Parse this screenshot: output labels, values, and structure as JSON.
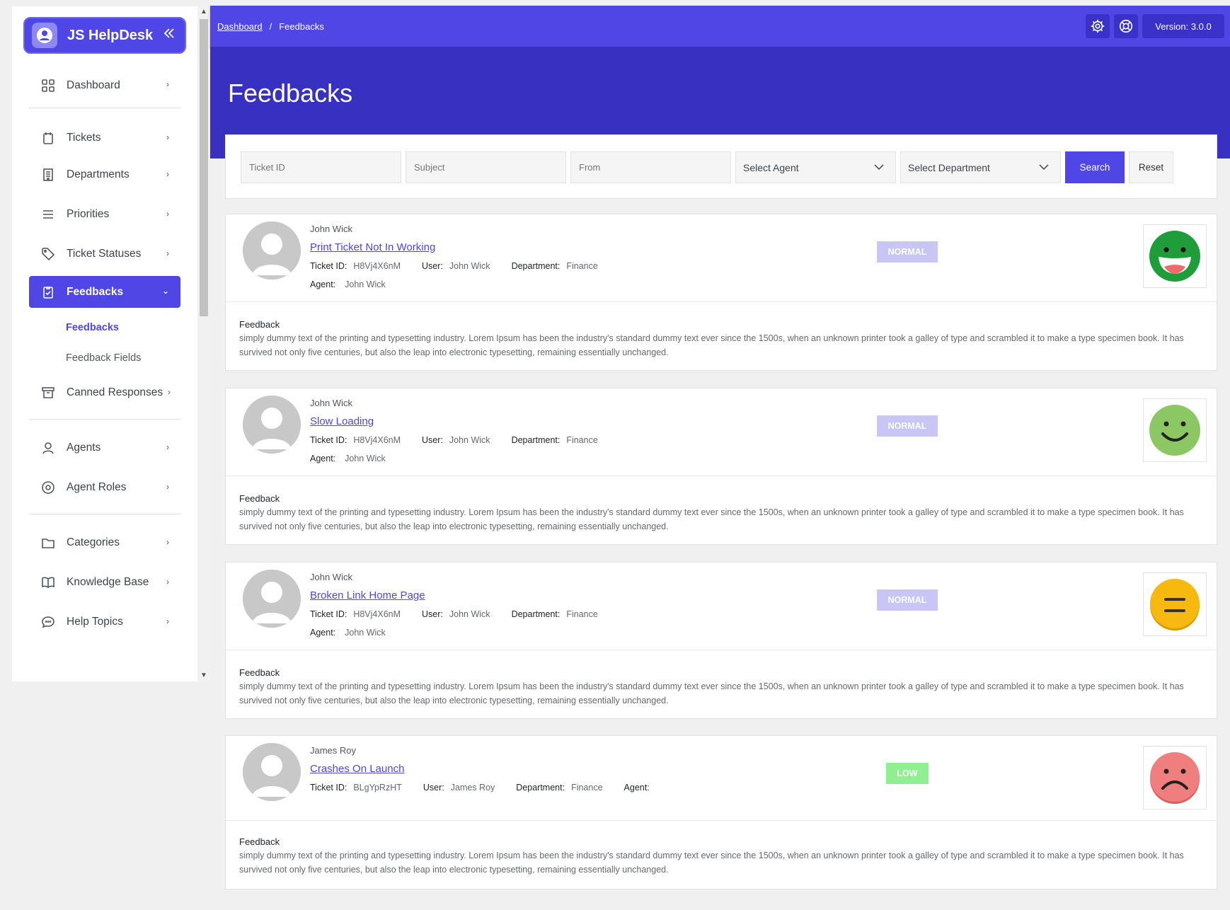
{
  "sidebar": {
    "brand": "JS HelpDesk",
    "items": [
      {
        "label": "Dashboard",
        "icon": "grid-icon"
      },
      {
        "label": "Tickets",
        "icon": "clipboard-icon"
      },
      {
        "label": "Departments",
        "icon": "building-icon"
      },
      {
        "label": "Priorities",
        "icon": "list-icon"
      },
      {
        "label": "Ticket Statuses",
        "icon": "tag-icon"
      },
      {
        "label": "Feedbacks",
        "icon": "clipboard-check-icon",
        "active": true
      },
      {
        "label": "Canned Responses",
        "icon": "archive-icon"
      },
      {
        "label": "Agents",
        "icon": "user-icon"
      },
      {
        "label": "Agent Roles",
        "icon": "target-icon"
      },
      {
        "label": "Categories",
        "icon": "folder-icon"
      },
      {
        "label": "Knowledge Base",
        "icon": "book-icon"
      },
      {
        "label": "Help Topics",
        "icon": "chat-icon"
      }
    ],
    "sub_items": [
      {
        "label": "Feedbacks",
        "active": true
      },
      {
        "label": "Feedback Fields"
      }
    ]
  },
  "header": {
    "breadcrumb_link": "Dashboard",
    "breadcrumb_sep": "/",
    "breadcrumb_current": "Feedbacks",
    "version": "Version: 3.0.0"
  },
  "page": {
    "title": "Feedbacks"
  },
  "filters": {
    "ticket_id_placeholder": "Ticket ID",
    "subject_placeholder": "Subject",
    "from_placeholder": "From",
    "agent_select": "Select Agent",
    "department_select": "Select Department",
    "search_label": "Search",
    "reset_label": "Reset"
  },
  "labels": {
    "ticket_id": "Ticket ID:",
    "user": "User:",
    "department": "Department:",
    "agent": "Agent:",
    "feedback": "Feedback"
  },
  "feedbacks": [
    {
      "name": "John Wick",
      "subject": "Print Ticket Not In Working",
      "ticket_id": "H8Vj4X6nM",
      "user": "John Wick",
      "department": "Finance",
      "agent": "John Wick",
      "priority": "NORMAL",
      "priority_color": "#c9c6f5",
      "rating_icon": "grinning-face-icon",
      "text": "simply dummy text of the printing and typesetting industry. Lorem Ipsum has been the industry's standard dummy text ever since the 1500s, when an unknown printer took a galley of type and scrambled it to make a type specimen book. It has survived not only five centuries, but also the leap into electronic typesetting, remaining essentially unchanged."
    },
    {
      "name": "John Wick",
      "subject": "Slow Loading",
      "ticket_id": "H8Vj4X6nM",
      "user": "John Wick",
      "department": "Finance",
      "agent": "John Wick",
      "priority": "NORMAL",
      "priority_color": "#c9c6f5",
      "rating_icon": "smiling-face-icon",
      "text": "simply dummy text of the printing and typesetting industry. Lorem Ipsum has been the industry's standard dummy text ever since the 1500s, when an unknown printer took a galley of type and scrambled it to make a type specimen book. It has survived not only five centuries, but also the leap into electronic typesetting, remaining essentially unchanged."
    },
    {
      "name": "John Wick",
      "subject": "Broken Link Home Page",
      "ticket_id": "H8Vj4X6nM",
      "user": "John Wick",
      "department": "Finance",
      "agent": "John Wick",
      "priority": "NORMAL",
      "priority_color": "#c9c6f5",
      "rating_icon": "neutral-face-icon",
      "text": "simply dummy text of the printing and typesetting industry. Lorem Ipsum has been the industry's standard dummy text ever since the 1500s, when an unknown printer took a galley of type and scrambled it to make a type specimen book. It has survived not only five centuries, but also the leap into electronic typesetting, remaining essentially unchanged."
    },
    {
      "name": "James Roy",
      "subject": "Crashes On Launch",
      "ticket_id": "BLgYpRzHT",
      "user": "James Roy",
      "department": "Finance",
      "agent": "",
      "priority": "LOW",
      "priority_color": "#8ef08e",
      "rating_icon": "frowning-face-icon",
      "text": "simply dummy text of the printing and typesetting industry. Lorem Ipsum has been the industry's standard dummy text ever since the 1500s, when an unknown printer took a galley of type and scrambled it to make a type specimen book. It has survived not only five centuries, but also the leap into electronic typesetting, remaining essentially unchanged."
    }
  ],
  "colors": {
    "primary": "#4f46e5",
    "hero": "#3730c0",
    "normal": "#c9c6f5",
    "low": "#8ef08e"
  }
}
